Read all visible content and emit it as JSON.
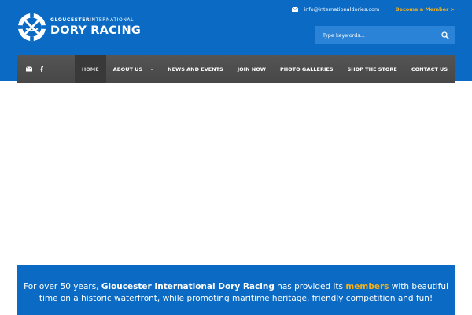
{
  "brand": {
    "subtitle_bold": "GLOUCESTER",
    "subtitle_light": "INTERNATIONAL",
    "name": "DORY RACING"
  },
  "header": {
    "email": "info@internationaldories.com",
    "separator": "|",
    "become_member": "Become a Member  >"
  },
  "search": {
    "placeholder": "Type keywords..."
  },
  "nav": {
    "items": [
      {
        "label": "HOME"
      },
      {
        "label": "ABOUT US"
      },
      {
        "label": "NEWS AND EVENTS"
      },
      {
        "label": "JOIN NOW"
      },
      {
        "label": "PHOTO GALLERIES"
      },
      {
        "label": "SHOP THE STORE"
      },
      {
        "label": "CONTACT US"
      }
    ]
  },
  "banner": {
    "part1": "For over 50 years, ",
    "org": "Gloucester International Dory Racing",
    "part2": " has provided its ",
    "highlight": "members",
    "part3": " with beautiful time on a historic waterfront, while promoting maritime heritage, friendly competition and fun!"
  },
  "colors": {
    "brand_blue": "#0b6bc4",
    "accent_orange": "#f5b01a",
    "nav_gray": "#4e4e4e",
    "nav_active": "#393939"
  },
  "icons": [
    "dory-racing-logo-icon",
    "mail-icon",
    "search-icon",
    "facebook-icon",
    "chevron-down-icon"
  ]
}
